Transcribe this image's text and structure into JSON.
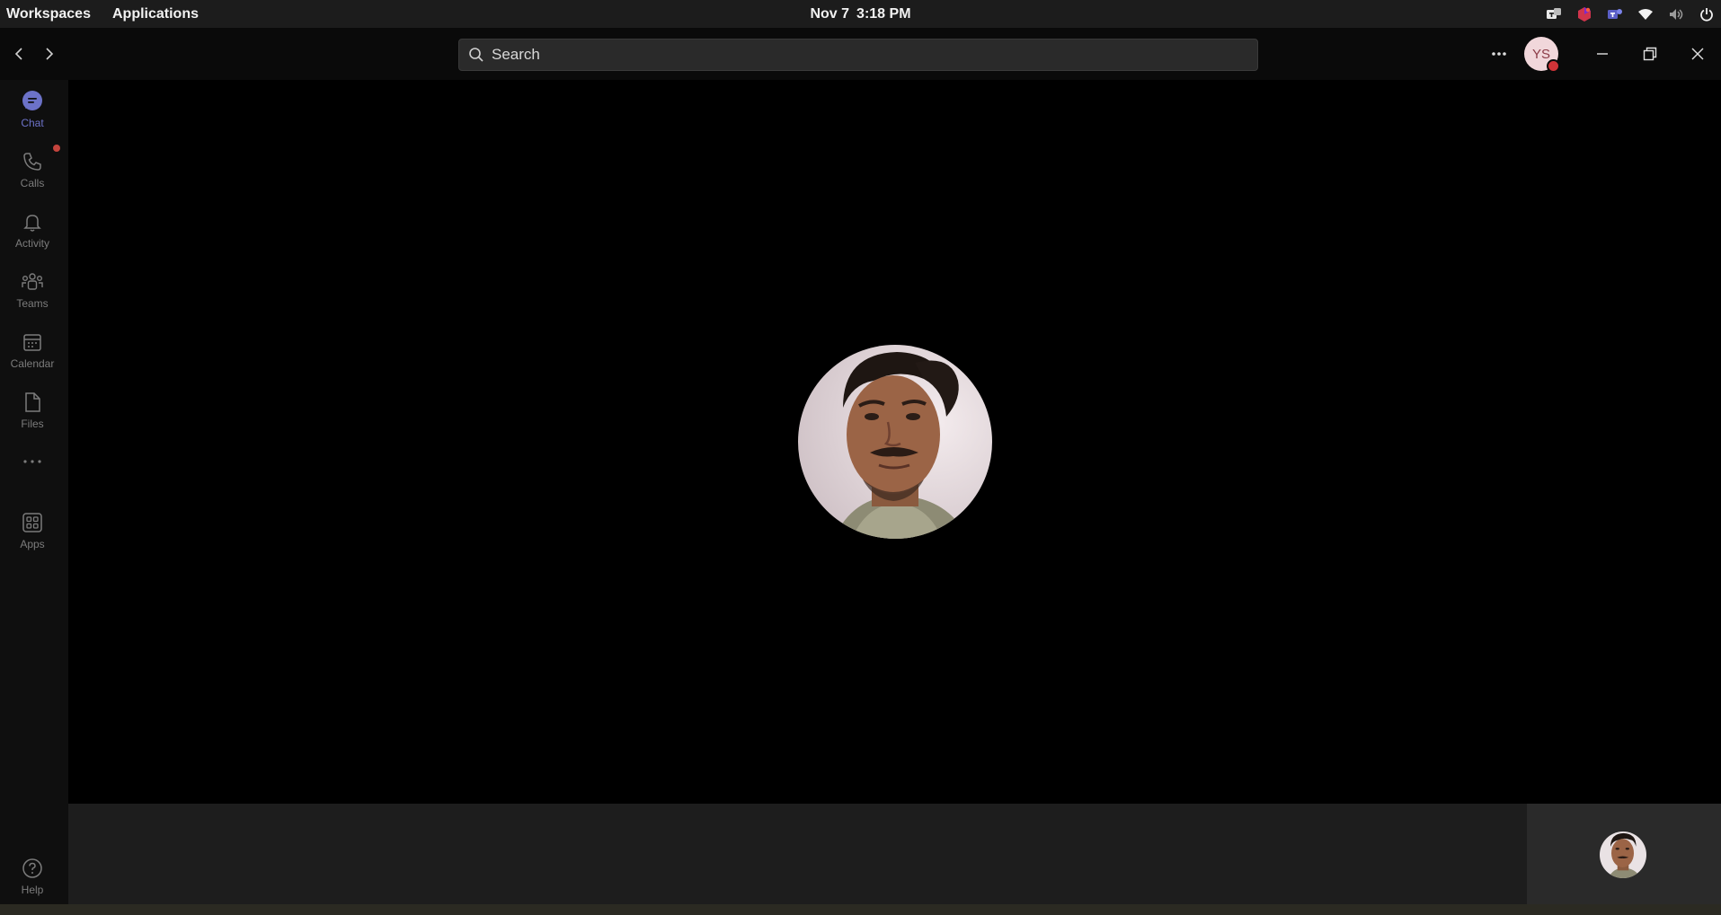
{
  "topbar": {
    "workspaces": "Workspaces",
    "applications": "Applications",
    "date": "Nov 7",
    "time": "3:18 PM",
    "tray_icons": [
      "teams-tray-icon",
      "app-tray-icon-red",
      "teams-tray-icon-blue",
      "wifi-icon",
      "volume-icon",
      "power-icon"
    ]
  },
  "search": {
    "placeholder": "Search"
  },
  "profile": {
    "initials": "YS",
    "presence": "busy"
  },
  "rail": {
    "items": [
      {
        "label": "Chat",
        "icon": "chat-icon",
        "active": true
      },
      {
        "label": "Calls",
        "icon": "phone-icon",
        "badge": true
      },
      {
        "label": "Activity",
        "icon": "bell-icon"
      },
      {
        "label": "Teams",
        "icon": "teams-icon"
      },
      {
        "label": "Calendar",
        "icon": "calendar-icon"
      },
      {
        "label": "Files",
        "icon": "file-icon"
      },
      {
        "label": "Apps",
        "icon": "apps-icon"
      }
    ],
    "help": "Help"
  },
  "colors": {
    "accent": "#6c72c8",
    "rail_inactive": "#7c7c7c",
    "presence_busy": "#d13438"
  }
}
